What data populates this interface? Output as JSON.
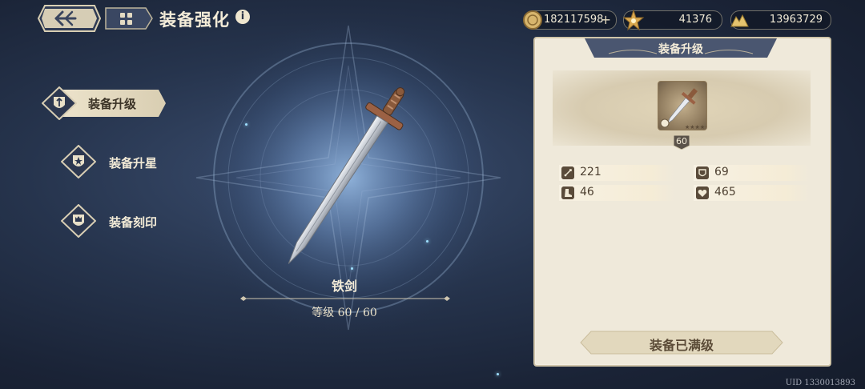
{
  "header": {
    "title": "装备强化",
    "info_icon": "info-icon",
    "back_icon": "back-arrow-icon",
    "menu_icon": "grid-menu-icon"
  },
  "currencies": [
    {
      "name": "gold-coin",
      "value": "182117598",
      "has_plus": true
    },
    {
      "name": "star-crystal",
      "value": "41376",
      "has_plus": false
    },
    {
      "name": "gold-pile",
      "value": "13963729",
      "has_plus": false
    }
  ],
  "nav": {
    "items": [
      {
        "label": "装备升级",
        "active": true,
        "icon": "shield-upgrade-icon"
      },
      {
        "label": "装备升星",
        "active": false,
        "icon": "shield-star-icon"
      },
      {
        "label": "装备刻印",
        "active": false,
        "icon": "shield-crown-icon"
      }
    ]
  },
  "center": {
    "item_name": "铁剑",
    "level_text": "等级 60 / 60"
  },
  "panel": {
    "title": "装备升级",
    "item_level": "60",
    "stars": 5,
    "stats": [
      {
        "icon": "sword-attack-icon",
        "value": "221"
      },
      {
        "icon": "shield-defense-icon",
        "value": "69"
      },
      {
        "icon": "boot-speed-icon",
        "value": "46"
      },
      {
        "icon": "heart-hp-icon",
        "value": "465"
      }
    ],
    "max_button_label": "装备已满级"
  },
  "footer": {
    "uid": "UID 1330013893"
  },
  "colors": {
    "panel_bg": "#efe9da",
    "panel_border": "#cfc4a8",
    "accent_gold": "#e6dcc0",
    "text_dark": "#4c3f30"
  }
}
